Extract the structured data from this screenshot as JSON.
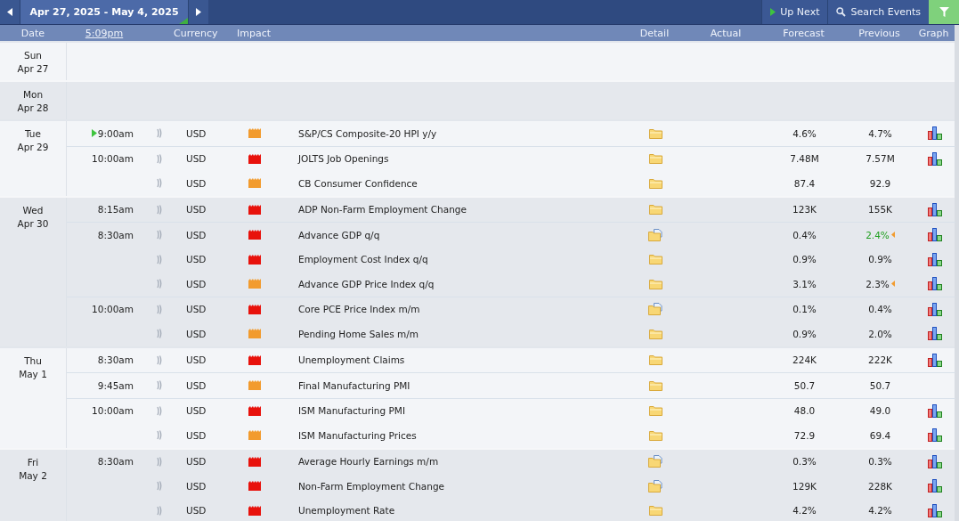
{
  "toolbar": {
    "range": "Apr 27, 2025 - May 4, 2025",
    "up_next": "Up Next",
    "search": "Search Events"
  },
  "columns": [
    "Date",
    "5:09pm",
    "Currency",
    "Impact",
    "Detail",
    "Actual",
    "Forecast",
    "Previous",
    "Graph"
  ],
  "days": [
    {
      "weekday": "Sun",
      "date": "Apr 27"
    },
    {
      "weekday": "Mon",
      "date": "Apr 28"
    },
    {
      "weekday": "Tue",
      "date": "Apr 29",
      "slots": [
        {
          "time": "9:00am",
          "up_next": true,
          "events": [
            {
              "currency": "USD",
              "high_impact": false,
              "title": "S&P/CS Composite-20 HPI y/y",
              "detail_note": false,
              "forecast": "4.6%",
              "previous": "4.7%",
              "previous_better": false,
              "revised": false,
              "graph": true
            }
          ]
        },
        {
          "time": "10:00am",
          "up_next": false,
          "events": [
            {
              "currency": "USD",
              "high_impact": true,
              "title": "JOLTS Job Openings",
              "detail_note": false,
              "forecast": "7.48M",
              "previous": "7.57M",
              "previous_better": false,
              "revised": false,
              "graph": true
            },
            {
              "currency": "USD",
              "high_impact": false,
              "title": "CB Consumer Confidence",
              "detail_note": false,
              "forecast": "87.4",
              "previous": "92.9",
              "previous_better": false,
              "revised": false,
              "graph": false
            }
          ]
        }
      ]
    },
    {
      "weekday": "Wed",
      "date": "Apr 30",
      "slots": [
        {
          "time": "8:15am",
          "up_next": false,
          "events": [
            {
              "currency": "USD",
              "high_impact": true,
              "title": "ADP Non-Farm Employment Change",
              "detail_note": false,
              "forecast": "123K",
              "previous": "155K",
              "previous_better": false,
              "revised": false,
              "graph": true
            }
          ]
        },
        {
          "time": "8:30am",
          "up_next": false,
          "events": [
            {
              "currency": "USD",
              "high_impact": true,
              "title": "Advance GDP q/q",
              "detail_note": true,
              "forecast": "0.4%",
              "previous": "2.4%",
              "previous_better": true,
              "revised": true,
              "graph": true
            },
            {
              "currency": "USD",
              "high_impact": true,
              "title": "Employment Cost Index q/q",
              "detail_note": false,
              "forecast": "0.9%",
              "previous": "0.9%",
              "previous_better": false,
              "revised": false,
              "graph": true
            },
            {
              "currency": "USD",
              "high_impact": false,
              "title": "Advance GDP Price Index q/q",
              "detail_note": false,
              "forecast": "3.1%",
              "previous": "2.3%",
              "previous_better": false,
              "revised": true,
              "graph": true
            }
          ]
        },
        {
          "time": "10:00am",
          "up_next": false,
          "events": [
            {
              "currency": "USD",
              "high_impact": true,
              "title": "Core PCE Price Index m/m",
              "detail_note": true,
              "forecast": "0.1%",
              "previous": "0.4%",
              "previous_better": false,
              "revised": false,
              "graph": true
            },
            {
              "currency": "USD",
              "high_impact": false,
              "title": "Pending Home Sales m/m",
              "detail_note": false,
              "forecast": "0.9%",
              "previous": "2.0%",
              "previous_better": false,
              "revised": false,
              "graph": true
            }
          ]
        }
      ]
    },
    {
      "weekday": "Thu",
      "date": "May 1",
      "slots": [
        {
          "time": "8:30am",
          "up_next": false,
          "events": [
            {
              "currency": "USD",
              "high_impact": true,
              "title": "Unemployment Claims",
              "detail_note": false,
              "forecast": "224K",
              "previous": "222K",
              "previous_better": false,
              "revised": false,
              "graph": true
            }
          ]
        },
        {
          "time": "9:45am",
          "up_next": false,
          "events": [
            {
              "currency": "USD",
              "high_impact": false,
              "title": "Final Manufacturing PMI",
              "detail_note": false,
              "forecast": "50.7",
              "previous": "50.7",
              "previous_better": false,
              "revised": false,
              "graph": false
            }
          ]
        },
        {
          "time": "10:00am",
          "up_next": false,
          "events": [
            {
              "currency": "USD",
              "high_impact": true,
              "title": "ISM Manufacturing PMI",
              "detail_note": false,
              "forecast": "48.0",
              "previous": "49.0",
              "previous_better": false,
              "revised": false,
              "graph": true
            },
            {
              "currency": "USD",
              "high_impact": false,
              "title": "ISM Manufacturing Prices",
              "detail_note": false,
              "forecast": "72.9",
              "previous": "69.4",
              "previous_better": false,
              "revised": false,
              "graph": true
            }
          ]
        }
      ]
    },
    {
      "weekday": "Fri",
      "date": "May 2",
      "slots": [
        {
          "time": "8:30am",
          "up_next": false,
          "events": [
            {
              "currency": "USD",
              "high_impact": true,
              "title": "Average Hourly Earnings m/m",
              "detail_note": true,
              "forecast": "0.3%",
              "previous": "0.3%",
              "previous_better": false,
              "revised": false,
              "graph": true
            },
            {
              "currency": "USD",
              "high_impact": true,
              "title": "Non-Farm Employment Change",
              "detail_note": true,
              "forecast": "129K",
              "previous": "228K",
              "previous_better": false,
              "revised": false,
              "graph": true
            },
            {
              "currency": "USD",
              "high_impact": true,
              "title": "Unemployment Rate",
              "detail_note": false,
              "forecast": "4.2%",
              "previous": "4.2%",
              "previous_better": false,
              "revised": false,
              "graph": true
            }
          ]
        }
      ]
    }
  ]
}
